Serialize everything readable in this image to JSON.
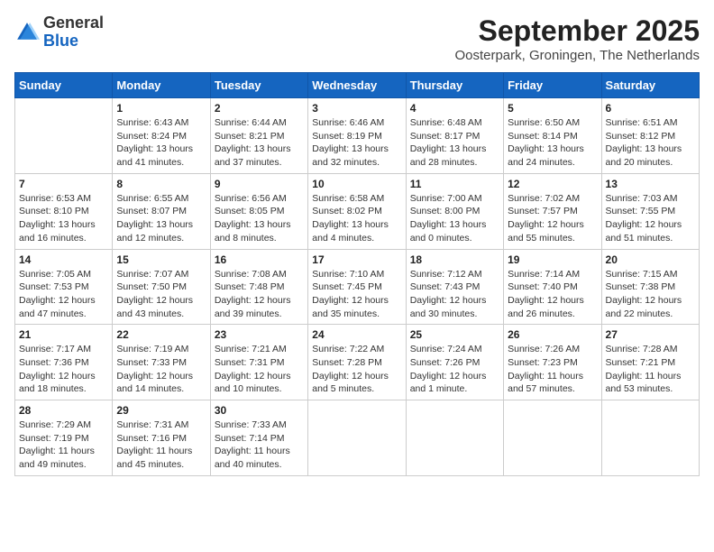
{
  "header": {
    "logo_general": "General",
    "logo_blue": "Blue",
    "month_title": "September 2025",
    "subtitle": "Oosterpark, Groningen, The Netherlands"
  },
  "days_of_week": [
    "Sunday",
    "Monday",
    "Tuesday",
    "Wednesday",
    "Thursday",
    "Friday",
    "Saturday"
  ],
  "weeks": [
    [
      {
        "day": "",
        "info": ""
      },
      {
        "day": "1",
        "info": "Sunrise: 6:43 AM\nSunset: 8:24 PM\nDaylight: 13 hours\nand 41 minutes."
      },
      {
        "day": "2",
        "info": "Sunrise: 6:44 AM\nSunset: 8:21 PM\nDaylight: 13 hours\nand 37 minutes."
      },
      {
        "day": "3",
        "info": "Sunrise: 6:46 AM\nSunset: 8:19 PM\nDaylight: 13 hours\nand 32 minutes."
      },
      {
        "day": "4",
        "info": "Sunrise: 6:48 AM\nSunset: 8:17 PM\nDaylight: 13 hours\nand 28 minutes."
      },
      {
        "day": "5",
        "info": "Sunrise: 6:50 AM\nSunset: 8:14 PM\nDaylight: 13 hours\nand 24 minutes."
      },
      {
        "day": "6",
        "info": "Sunrise: 6:51 AM\nSunset: 8:12 PM\nDaylight: 13 hours\nand 20 minutes."
      }
    ],
    [
      {
        "day": "7",
        "info": "Sunrise: 6:53 AM\nSunset: 8:10 PM\nDaylight: 13 hours\nand 16 minutes."
      },
      {
        "day": "8",
        "info": "Sunrise: 6:55 AM\nSunset: 8:07 PM\nDaylight: 13 hours\nand 12 minutes."
      },
      {
        "day": "9",
        "info": "Sunrise: 6:56 AM\nSunset: 8:05 PM\nDaylight: 13 hours\nand 8 minutes."
      },
      {
        "day": "10",
        "info": "Sunrise: 6:58 AM\nSunset: 8:02 PM\nDaylight: 13 hours\nand 4 minutes."
      },
      {
        "day": "11",
        "info": "Sunrise: 7:00 AM\nSunset: 8:00 PM\nDaylight: 13 hours\nand 0 minutes."
      },
      {
        "day": "12",
        "info": "Sunrise: 7:02 AM\nSunset: 7:57 PM\nDaylight: 12 hours\nand 55 minutes."
      },
      {
        "day": "13",
        "info": "Sunrise: 7:03 AM\nSunset: 7:55 PM\nDaylight: 12 hours\nand 51 minutes."
      }
    ],
    [
      {
        "day": "14",
        "info": "Sunrise: 7:05 AM\nSunset: 7:53 PM\nDaylight: 12 hours\nand 47 minutes."
      },
      {
        "day": "15",
        "info": "Sunrise: 7:07 AM\nSunset: 7:50 PM\nDaylight: 12 hours\nand 43 minutes."
      },
      {
        "day": "16",
        "info": "Sunrise: 7:08 AM\nSunset: 7:48 PM\nDaylight: 12 hours\nand 39 minutes."
      },
      {
        "day": "17",
        "info": "Sunrise: 7:10 AM\nSunset: 7:45 PM\nDaylight: 12 hours\nand 35 minutes."
      },
      {
        "day": "18",
        "info": "Sunrise: 7:12 AM\nSunset: 7:43 PM\nDaylight: 12 hours\nand 30 minutes."
      },
      {
        "day": "19",
        "info": "Sunrise: 7:14 AM\nSunset: 7:40 PM\nDaylight: 12 hours\nand 26 minutes."
      },
      {
        "day": "20",
        "info": "Sunrise: 7:15 AM\nSunset: 7:38 PM\nDaylight: 12 hours\nand 22 minutes."
      }
    ],
    [
      {
        "day": "21",
        "info": "Sunrise: 7:17 AM\nSunset: 7:36 PM\nDaylight: 12 hours\nand 18 minutes."
      },
      {
        "day": "22",
        "info": "Sunrise: 7:19 AM\nSunset: 7:33 PM\nDaylight: 12 hours\nand 14 minutes."
      },
      {
        "day": "23",
        "info": "Sunrise: 7:21 AM\nSunset: 7:31 PM\nDaylight: 12 hours\nand 10 minutes."
      },
      {
        "day": "24",
        "info": "Sunrise: 7:22 AM\nSunset: 7:28 PM\nDaylight: 12 hours\nand 5 minutes."
      },
      {
        "day": "25",
        "info": "Sunrise: 7:24 AM\nSunset: 7:26 PM\nDaylight: 12 hours\nand 1 minute."
      },
      {
        "day": "26",
        "info": "Sunrise: 7:26 AM\nSunset: 7:23 PM\nDaylight: 11 hours\nand 57 minutes."
      },
      {
        "day": "27",
        "info": "Sunrise: 7:28 AM\nSunset: 7:21 PM\nDaylight: 11 hours\nand 53 minutes."
      }
    ],
    [
      {
        "day": "28",
        "info": "Sunrise: 7:29 AM\nSunset: 7:19 PM\nDaylight: 11 hours\nand 49 minutes."
      },
      {
        "day": "29",
        "info": "Sunrise: 7:31 AM\nSunset: 7:16 PM\nDaylight: 11 hours\nand 45 minutes."
      },
      {
        "day": "30",
        "info": "Sunrise: 7:33 AM\nSunset: 7:14 PM\nDaylight: 11 hours\nand 40 minutes."
      },
      {
        "day": "",
        "info": ""
      },
      {
        "day": "",
        "info": ""
      },
      {
        "day": "",
        "info": ""
      },
      {
        "day": "",
        "info": ""
      }
    ]
  ]
}
